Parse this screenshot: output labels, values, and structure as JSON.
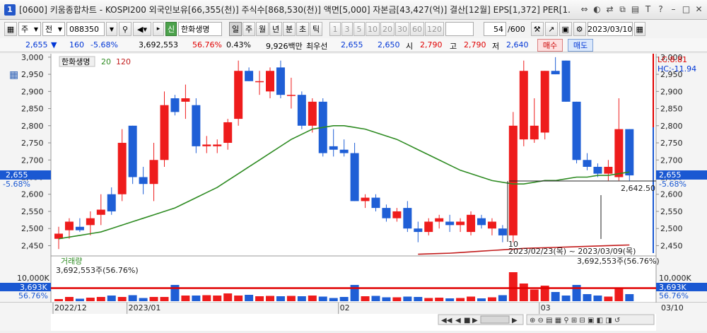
{
  "window": {
    "app_badge": "1",
    "title": "[0600] 키움종합차트 - KOSPI200 외국인보유[66,355(천)] 주식수[868,530(천)] 액면[5,000] 자본금[43,427(억)] 결산[12월] EPS[1,372] PER[1."
  },
  "toolbar": {
    "market_label": "주",
    "mode_label": "전",
    "stock_code": "088350",
    "stock_name": "한화생명",
    "stock_tag": "신",
    "periods": [
      "일",
      "주",
      "월",
      "년",
      "분",
      "초",
      "틱"
    ],
    "selected_period": "일",
    "intervals": [
      "1",
      "3",
      "5",
      "10",
      "20",
      "30",
      "60",
      "120"
    ],
    "count": "54",
    "count_total": "/600",
    "date": "2023/03/10"
  },
  "info": {
    "price": "2,655",
    "change": "160",
    "change_pct": "-5.68%",
    "volume": "3,692,553",
    "volume_pct": "56.76%",
    "turnover": "0.43%",
    "amount": "9,926백만",
    "best_label": "최우선",
    "best_ask": "2,655",
    "best_bid": "2,650",
    "open_label": "시",
    "open": "2,790",
    "high_label": "고",
    "high": "2,790",
    "low_label": "저",
    "low": "2,640",
    "buy_label": "매수",
    "sell_label": "매도"
  },
  "chart": {
    "legend_name": "한화생명",
    "ma_short": "20",
    "ma_long": "120",
    "lc_label": "LC:8.81",
    "hc_label": "HC:-11.94",
    "current_price_label": "2,655",
    "current_pct_label": "-5.68%",
    "annot_price": "2,642.50",
    "annot_count": "10",
    "annot_range": "2023/02/23(목) ~ 2023/03/09(목)",
    "volume_title": "거래량",
    "volume_value": "3,692,553주(56.76%)",
    "volume_value_right": "3,692,553주(56.76%)",
    "volume_max_label": "10,000K",
    "volume_cur_label": "3,693K",
    "volume_pct_label": "56.76%",
    "colors": {
      "up": "#ee1c1c",
      "down": "#1f5fd6",
      "ma20": "#2e8b22",
      "ma120": "#c21b1b"
    }
  },
  "chart_data": {
    "type": "candlestick",
    "y_ticks": [
      "3,000",
      "2,950",
      "2,900",
      "2,850",
      "2,800",
      "2,750",
      "2,700",
      "2,650",
      "2,600",
      "2,550",
      "2,500",
      "2,450"
    ],
    "ylim": [
      2420,
      3010
    ],
    "x_labels": [
      "2022/12",
      "2023/01",
      "02",
      "03"
    ],
    "x_right_label": "03/10",
    "candles": [
      [
        2470,
        2505,
        2440,
        2485
      ],
      [
        2495,
        2530,
        2470,
        2520
      ],
      [
        2505,
        2530,
        2490,
        2495
      ],
      [
        2510,
        2550,
        2480,
        2530
      ],
      [
        2540,
        2600,
        2510,
        2555
      ],
      [
        2600,
        2620,
        2540,
        2550
      ],
      [
        2600,
        2790,
        2580,
        2750
      ],
      [
        2800,
        2800,
        2630,
        2650
      ],
      [
        2650,
        2680,
        2600,
        2630
      ],
      [
        2630,
        2750,
        2580,
        2700
      ],
      [
        2700,
        2900,
        2680,
        2860
      ],
      [
        2880,
        2890,
        2830,
        2840
      ],
      [
        2870,
        2920,
        2820,
        2880
      ],
      [
        2860,
        2880,
        2720,
        2740
      ],
      [
        2740,
        2770,
        2720,
        2745
      ],
      [
        2740,
        2760,
        2720,
        2745
      ],
      [
        2750,
        2820,
        2730,
        2810
      ],
      [
        2820,
        2990,
        2800,
        2960
      ],
      [
        2960,
        2970,
        2930,
        2930
      ],
      [
        2930,
        2960,
        2890,
        2930
      ],
      [
        2900,
        2970,
        2880,
        2960
      ],
      [
        2970,
        2990,
        2880,
        2890
      ],
      [
        2890,
        2940,
        2850,
        2890
      ],
      [
        2890,
        2900,
        2790,
        2800
      ],
      [
        2800,
        2880,
        2780,
        2870
      ],
      [
        2870,
        2880,
        2710,
        2720
      ],
      [
        2740,
        2790,
        2710,
        2730
      ],
      [
        2730,
        2760,
        2710,
        2720
      ],
      [
        2720,
        2750,
        2580,
        2580
      ],
      [
        2580,
        2600,
        2560,
        2590
      ],
      [
        2590,
        2600,
        2550,
        2560
      ],
      [
        2560,
        2570,
        2520,
        2530
      ],
      [
        2530,
        2560,
        2520,
        2550
      ],
      [
        2560,
        2580,
        2490,
        2500
      ],
      [
        2500,
        2520,
        2460,
        2490
      ],
      [
        2490,
        2530,
        2480,
        2520
      ],
      [
        2520,
        2540,
        2500,
        2530
      ],
      [
        2520,
        2540,
        2490,
        2510
      ],
      [
        2510,
        2530,
        2490,
        2520
      ],
      [
        2490,
        2550,
        2480,
        2540
      ],
      [
        2530,
        2540,
        2500,
        2510
      ],
      [
        2500,
        2530,
        2480,
        2520
      ],
      [
        2500,
        2510,
        2460,
        2480
      ],
      [
        2480,
        2840,
        2460,
        2800
      ],
      [
        2760,
        2990,
        2740,
        2960
      ],
      [
        2760,
        2880,
        2750,
        2800
      ],
      [
        2780,
        2960,
        2760,
        2960
      ],
      [
        2960,
        3000,
        2950,
        2950
      ],
      [
        2990,
        2990,
        2870,
        2870
      ],
      [
        2870,
        2870,
        2690,
        2700
      ],
      [
        2700,
        2720,
        2670,
        2680
      ],
      [
        2680,
        2690,
        2650,
        2660
      ],
      [
        2660,
        2700,
        2640,
        2680
      ],
      [
        2650,
        2880,
        2640,
        2790
      ],
      [
        2790,
        2790,
        2640,
        2655
      ]
    ],
    "ma20": [
      2470,
      2475,
      2480,
      2485,
      2490,
      2500,
      2510,
      2520,
      2530,
      2540,
      2550,
      2560,
      2575,
      2590,
      2605,
      2620,
      2640,
      2660,
      2680,
      2700,
      2720,
      2740,
      2760,
      2775,
      2790,
      2795,
      2800,
      2800,
      2795,
      2790,
      2780,
      2770,
      2760,
      2745,
      2730,
      2715,
      2700,
      2685,
      2670,
      2660,
      2650,
      2640,
      2635,
      2630,
      2630,
      2635,
      2640,
      2640,
      2645,
      2650,
      2650,
      2655,
      2655,
      2660,
      2665
    ],
    "ma120": [
      2425,
      2426,
      2427,
      2428,
      2430,
      2432,
      2434,
      2436,
      2438,
      2440,
      2442,
      2443,
      2444,
      2445,
      2446,
      2447,
      2448,
      2449,
      2450,
      2451,
      2452
    ],
    "ma120_start_index": 34,
    "volumes": [
      600,
      1200,
      700,
      1000,
      1200,
      1600,
      1200,
      1700,
      900,
      1200,
      1200,
      4600,
      1600,
      1600,
      1700,
      1600,
      2200,
      1600,
      1800,
      1400,
      1500,
      1400,
      1500,
      1400,
      1600,
      1300,
      900,
      1200,
      4600,
      1400,
      1500,
      1100,
      1100,
      1300,
      1200,
      900,
      1000,
      800,
      900,
      1300,
      800,
      1100,
      1700,
      8200,
      5000,
      3300,
      4400,
      2600,
      1600,
      4600,
      2000,
      1600,
      1300,
      3692,
      2000
    ],
    "volume_ylim": [
      0,
      10000
    ],
    "volume_ref_level": 3693
  }
}
